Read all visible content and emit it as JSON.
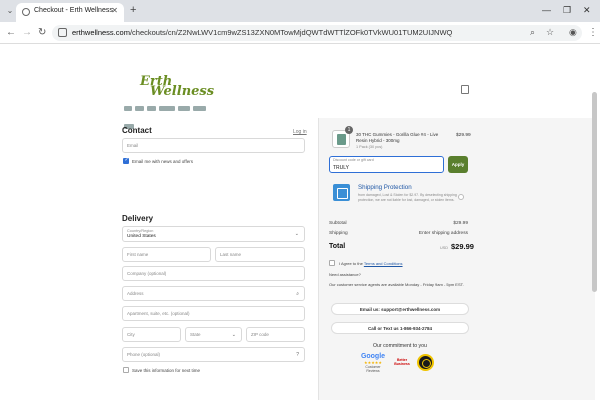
{
  "browser": {
    "tab_title": "Checkout - Erth Wellness",
    "url_domain": "erthwellness.com",
    "url_path": "/checkouts/cn/Z2NwLWV1cm9wZS13ZXN0MTowMjdQWTdWTTlZOFk0TVkWU01TUM2UIJNWQ"
  },
  "brand": {
    "name_line1": "Erth",
    "name_line2": "Wellness",
    "color": "#6b8e23"
  },
  "contact": {
    "title": "Contact",
    "login_link": "Log in",
    "email_placeholder": "Email",
    "offers_label": "Email me with news and offers"
  },
  "delivery": {
    "title": "Delivery",
    "country_label": "Country/Region",
    "country_value": "United States",
    "first_name": "First name",
    "last_name": "Last name",
    "company": "Company (optional)",
    "address": "Address",
    "apartment": "Apartment, suite, etc. (optional)",
    "city": "City",
    "state": "State",
    "zip": "ZIP code",
    "phone": "Phone (optional)",
    "save_info": "Save this information for next time"
  },
  "order": {
    "quantity": "1",
    "product_name": "30 THC Gummies - Gorilla Glue #4 - Live Resin Hybrid - 300mg",
    "product_sub": "1 Pack (30 pcs)",
    "product_price": "$29.99",
    "discount_label": "Discount code or gift card",
    "discount_value": "TRULY",
    "apply_label": "Apply",
    "shipping_protection_title": "Shipping Protection",
    "shipping_protection_desc": "from damaged, Lost & Stolen for $2.97. By deselecting shipping protection, we are not liable for lost, damaged, or stolen items.",
    "subtotal_label": "Subtotal",
    "subtotal_value": "$29.99",
    "shipping_label": "Shipping",
    "shipping_value": "Enter shipping address",
    "total_label": "Total",
    "total_currency": "USD",
    "total_value": "$29.99",
    "agree_label": "I Agree to the",
    "agree_link": "Terms and Conditions",
    "need_assistance": "Need assistance?",
    "hours_text": "Our customer service agents are available Monday - Friday 9am - 5pm EST.",
    "email_button": "Email us: support@erthwellness.com",
    "text_button": "Call or Text us 1-866-934-2784",
    "commitment": "Our commitment to you"
  },
  "badges": {
    "google": "Google",
    "google_sub": "Customer Reviews",
    "bbb": "Better Business"
  }
}
